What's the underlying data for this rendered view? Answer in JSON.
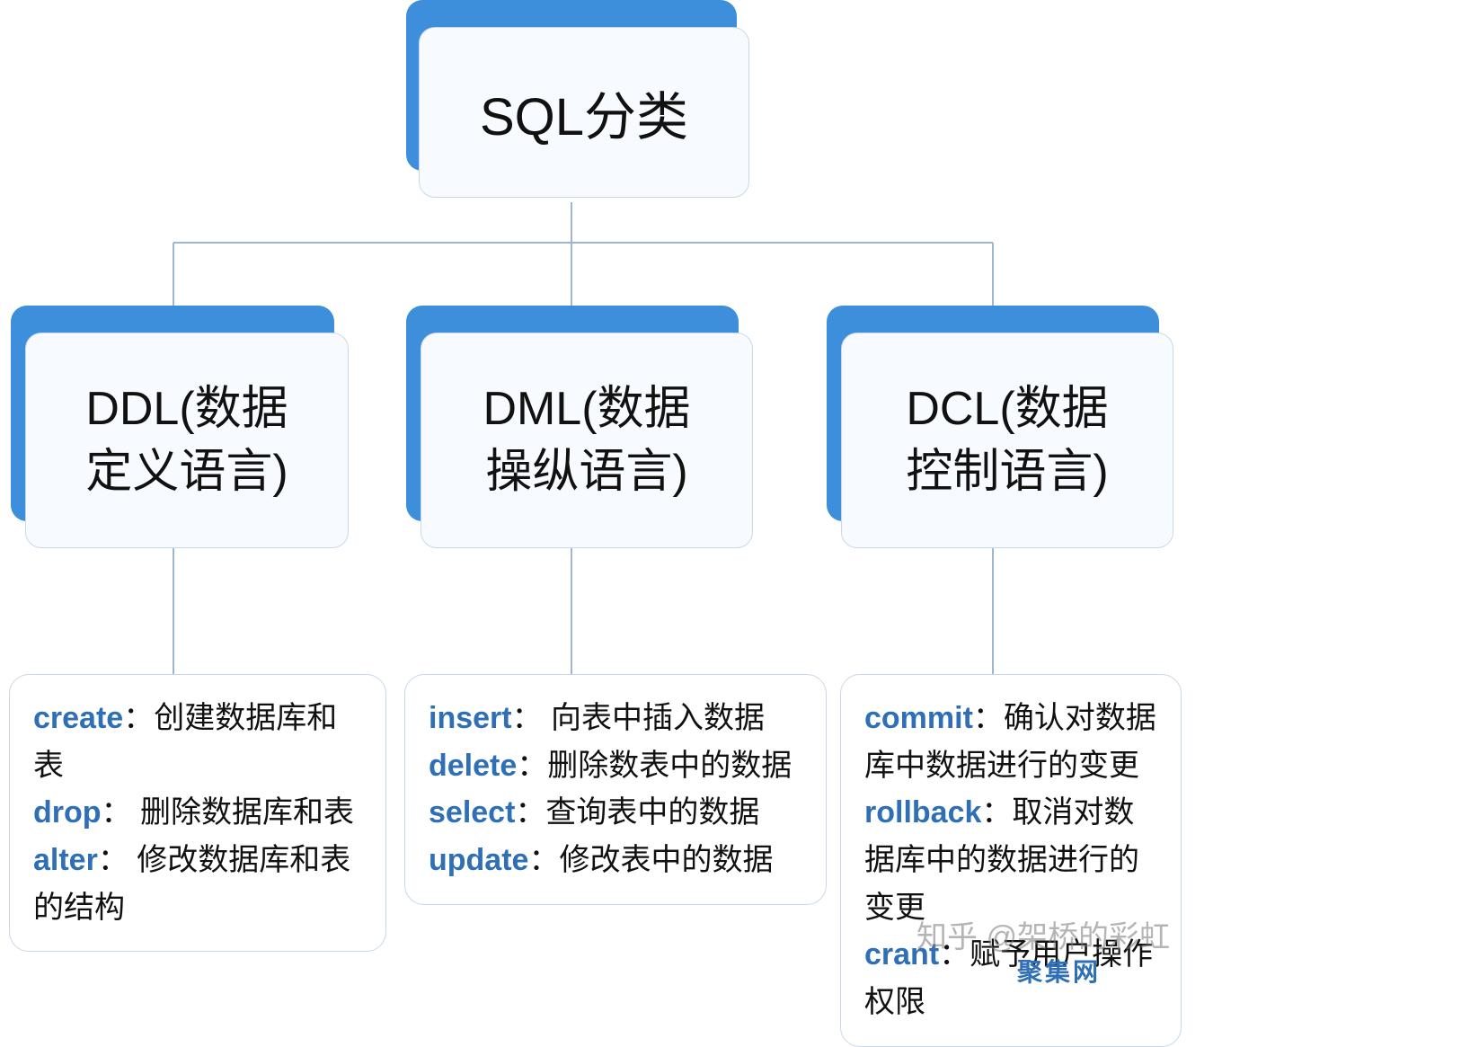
{
  "root": {
    "title": "SQL分类"
  },
  "branches": [
    {
      "title_l1": "DDL(数据",
      "title_l2": "定义语言)",
      "items": [
        {
          "kw": "create",
          "desc": "创建数据库和表"
        },
        {
          "kw": "drop",
          "desc": "删除数据库和表"
        },
        {
          "kw": "alter",
          "desc": "修改数据库和表的结构"
        }
      ]
    },
    {
      "title_l1": "DML(数据",
      "title_l2": "操纵语言)",
      "items": [
        {
          "kw": "insert",
          "desc": "向表中插入数据"
        },
        {
          "kw": "delete",
          "desc": "删除数表中的数据"
        },
        {
          "kw": "select",
          "desc": "查询表中的数据"
        },
        {
          "kw": "update",
          "desc": "修改表中的数据"
        }
      ]
    },
    {
      "title_l1": "DCL(数据",
      "title_l2": "控制语言)",
      "items": [
        {
          "kw": "commit",
          "desc": "确认对数据库中数据进行的变更"
        },
        {
          "kw": "rollback",
          "desc": "取消对数据库中的数据进行的变更"
        },
        {
          "kw": "crant",
          "desc": "赋予用户操作权限"
        }
      ]
    }
  ],
  "watermarks": {
    "zhihu": "知乎 @架桥的彩虹",
    "site": "聚集网"
  },
  "colors": {
    "accent": "#3d8fdc",
    "keyword": "#2f6fb5"
  }
}
